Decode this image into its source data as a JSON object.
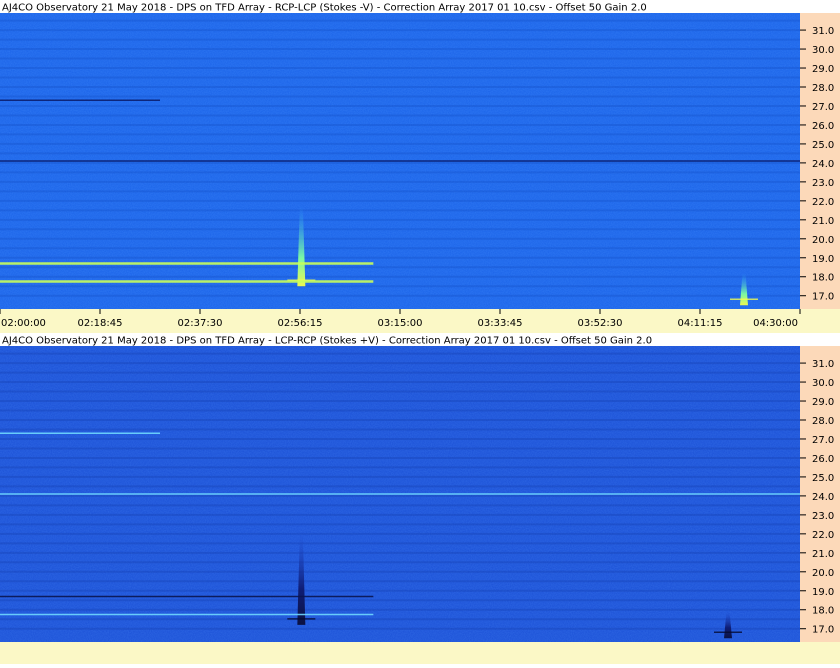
{
  "colors": {
    "header_bg": "#ffffff",
    "axis_bg": "#fcd9b9",
    "time_bar_bg": "#fbf8c6",
    "top_panel_base": "#1a62e8",
    "bottom_panel_base": "#1a4fd6",
    "text": "#000000"
  },
  "chart_data": [
    {
      "type": "heatmap",
      "title": "AJ4CO Observatory 21 May 2018  -  DPS on TFD Array  -  RCP-LCP (Stokes -V)  -  Correction Array 2017 01 10.csv  -  Offset 50  Gain 2.0",
      "y_ticks": [
        "31.0",
        "30.0",
        "29.0",
        "28.0",
        "27.0",
        "26.0",
        "25.0",
        "24.0",
        "23.0",
        "22.0",
        "21.0",
        "20.0",
        "19.0",
        "18.0",
        "17.0"
      ],
      "y_tick_values": [
        31,
        30,
        29,
        28,
        27,
        26,
        25,
        24,
        23,
        22,
        21,
        20,
        19,
        18,
        17
      ],
      "ylim": [
        16.3,
        31.9
      ],
      "x_ticks": [
        "02:00:00",
        "02:18:45",
        "02:37:30",
        "02:56:15",
        "03:15:00",
        "03:33:45",
        "03:52:30",
        "04:11:15",
        "04:30:00"
      ],
      "x_tick_minutes": [
        0,
        18.75,
        37.5,
        56.25,
        75,
        93.75,
        112.5,
        131.25,
        150
      ],
      "xlim_minutes": [
        0,
        150
      ],
      "features": [
        {
          "kind": "burst",
          "t": 56.5,
          "f_low": 17.5,
          "f_high": 21.8,
          "polarity": "bright"
        },
        {
          "kind": "burst",
          "t": 139.5,
          "f_low": 16.5,
          "f_high": 18.2,
          "polarity": "bright"
        },
        {
          "kind": "rfi_line",
          "f": 24.1,
          "polarity": "dark"
        },
        {
          "kind": "rfi_line",
          "f": 27.3,
          "t_end": 30,
          "polarity": "dark"
        },
        {
          "kind": "rfi_line",
          "f": 18.7,
          "t_end": 70,
          "polarity": "bright"
        },
        {
          "kind": "rfi_line",
          "f": 17.75,
          "t_end": 70,
          "polarity": "bright"
        }
      ]
    },
    {
      "type": "heatmap",
      "title": "AJ4CO Observatory 21 May 2018  -  DPS on TFD Array  -  LCP-RCP (Stokes +V)  -  Correction Array 2017 01 10.csv  -  Offset 50  Gain 2.0",
      "y_ticks": [
        "31.0",
        "30.0",
        "29.0",
        "28.0",
        "27.0",
        "26.0",
        "25.0",
        "24.0",
        "23.0",
        "22.0",
        "21.0",
        "20.0",
        "19.0",
        "18.0",
        "17.0"
      ],
      "y_tick_values": [
        31,
        30,
        29,
        28,
        27,
        26,
        25,
        24,
        23,
        22,
        21,
        20,
        19,
        18,
        17
      ],
      "ylim": [
        16.3,
        31.9
      ],
      "x_ticks": [],
      "xlim_minutes": [
        0,
        150
      ],
      "features": [
        {
          "kind": "burst",
          "t": 56.5,
          "f_low": 17.2,
          "f_high": 22.0,
          "polarity": "dark"
        },
        {
          "kind": "burst",
          "t": 136.5,
          "f_low": 16.5,
          "f_high": 17.9,
          "polarity": "dark"
        },
        {
          "kind": "rfi_line",
          "f": 24.1,
          "polarity": "bright"
        },
        {
          "kind": "rfi_line",
          "f": 27.3,
          "t_end": 30,
          "polarity": "bright"
        },
        {
          "kind": "rfi_line",
          "f": 18.7,
          "t_end": 70,
          "polarity": "dark"
        },
        {
          "kind": "rfi_line",
          "f": 17.75,
          "t_end": 70,
          "polarity": "bright"
        }
      ]
    }
  ]
}
